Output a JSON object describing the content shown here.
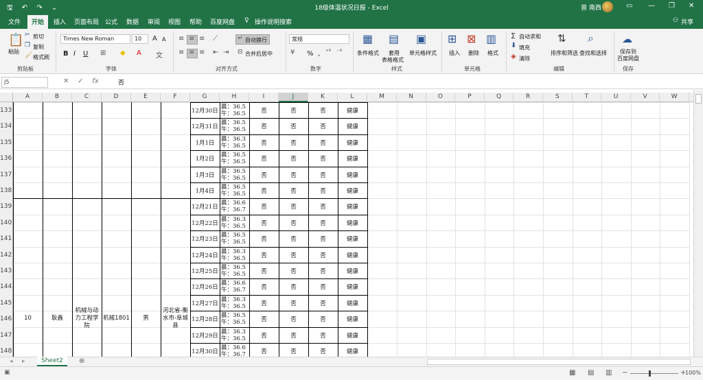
{
  "titlebar": {
    "title": "18级体温状况日报  -  Excel",
    "user": "曾 南西",
    "qa_save": "🖫",
    "qa_undo": "↶",
    "qa_redo": "↷",
    "qa_more": "⌄",
    "win_ribbon": "▭",
    "win_min": "—",
    "win_max": "❐",
    "win_close": "✕"
  },
  "tabs": {
    "items": [
      "文件",
      "开始",
      "插入",
      "页面布局",
      "公式",
      "数据",
      "审阅",
      "视图",
      "帮助",
      "百度网盘"
    ],
    "tell_me": "操作说明搜索",
    "share": "共享"
  },
  "ribbon": {
    "clipboard": {
      "paste": "粘贴",
      "cut": "剪切",
      "copy": "复制",
      "format_painter": "格式刷",
      "label": "剪贴板"
    },
    "font": {
      "name": "Times New Roman",
      "size": "10",
      "bold": "B",
      "italic": "I",
      "underline": "U",
      "label": "字体",
      "grow": "A",
      "shrink": "A"
    },
    "alignment": {
      "wrap": "自动换行",
      "merge": "合并后居中",
      "label": "对齐方式"
    },
    "number": {
      "format": "常规",
      "percent": "%",
      "comma": ",",
      "label": "数字"
    },
    "styles": {
      "conditional": "条件格式",
      "table_line1": "套用",
      "table_line2": "表格格式",
      "cell": "单元格样式",
      "label": "样式"
    },
    "cells": {
      "insert": "插入",
      "delete": "删除",
      "format": "格式",
      "label": "单元格"
    },
    "editing": {
      "autosum": "自动求和",
      "fill": "填充",
      "clear": "清除",
      "sort": "排序和筛选",
      "find": "查找和选择",
      "label": "编辑"
    },
    "save": {
      "line1": "保存到",
      "line2": "百度网盘",
      "label": "保存"
    }
  },
  "formula_bar": {
    "name_box": "J5",
    "fx": "fx",
    "value": "否"
  },
  "columns": [
    "A",
    "B",
    "C",
    "D",
    "E",
    "F",
    "G",
    "H",
    "I",
    "J",
    "K",
    "L",
    "M",
    "N",
    "O",
    "P",
    "Q",
    "R",
    "S",
    "T",
    "U",
    "V",
    "W"
  ],
  "selected_column": "J",
  "rows": [
    {
      "num": "133",
      "date": "12月30日",
      "temp_am": "晨：36.5",
      "temp_pm": "午：36.5",
      "i": "否",
      "j": "否",
      "k": "否",
      "l": "健康"
    },
    {
      "num": "134",
      "date": "12月31日",
      "temp_am": "晨：36.5",
      "temp_pm": "午：36.5",
      "i": "否",
      "j": "否",
      "k": "否",
      "l": "健康"
    },
    {
      "num": "135",
      "date": "1月1日",
      "temp_am": "晨：36.3",
      "temp_pm": "午：36.5",
      "i": "否",
      "j": "否",
      "k": "否",
      "l": "健康"
    },
    {
      "num": "136",
      "date": "1月2日",
      "temp_am": "晨：36.5",
      "temp_pm": "午：36.5",
      "i": "否",
      "j": "否",
      "k": "否",
      "l": "健康"
    },
    {
      "num": "137",
      "date": "1月3日",
      "temp_am": "晨：36.5",
      "temp_pm": "午：36.5",
      "i": "否",
      "j": "否",
      "k": "否",
      "l": "健康"
    },
    {
      "num": "138",
      "date": "1月4日",
      "temp_am": "晨：36.5",
      "temp_pm": "午：36.5",
      "i": "否",
      "j": "否",
      "k": "否",
      "l": "健康"
    },
    {
      "num": "139",
      "date": "12月21日",
      "temp_am": "晨：36.6",
      "temp_pm": "午：36.7",
      "i": "否",
      "j": "否",
      "k": "否",
      "l": "健康"
    },
    {
      "num": "140",
      "date": "12月22日",
      "temp_am": "晨：36.3",
      "temp_pm": "午：36.5",
      "i": "否",
      "j": "否",
      "k": "否",
      "l": "健康"
    },
    {
      "num": "141",
      "date": "12月23日",
      "temp_am": "晨：36.5",
      "temp_pm": "午：36.5",
      "i": "否",
      "j": "否",
      "k": "否",
      "l": "健康"
    },
    {
      "num": "142",
      "date": "12月24日",
      "temp_am": "晨：36.3",
      "temp_pm": "午：36.5",
      "i": "否",
      "j": "否",
      "k": "否",
      "l": "健康"
    },
    {
      "num": "143",
      "date": "12月25日",
      "temp_am": "晨：36.5",
      "temp_pm": "午：36.5",
      "i": "否",
      "j": "否",
      "k": "否",
      "l": "健康"
    },
    {
      "num": "144",
      "date": "12月26日",
      "temp_am": "晨：36.6",
      "temp_pm": "午：36.7",
      "i": "否",
      "j": "否",
      "k": "否",
      "l": "健康"
    },
    {
      "num": "145",
      "date": "12月27日",
      "temp_am": "晨：36.3",
      "temp_pm": "午：36.5",
      "i": "否",
      "j": "否",
      "k": "否",
      "l": "健康"
    },
    {
      "num": "146",
      "date": "12月28日",
      "temp_am": "晨：36.5",
      "temp_pm": "午：36.5",
      "i": "否",
      "j": "否",
      "k": "否",
      "l": "健康"
    },
    {
      "num": "147",
      "date": "12月29日",
      "temp_am": "晨：36.3",
      "temp_pm": "午：36.5",
      "i": "否",
      "j": "否",
      "k": "否",
      "l": "健康"
    },
    {
      "num": "148",
      "date": "12月30日",
      "temp_am": "晨：36.6",
      "temp_pm": "午：36.7",
      "i": "否",
      "j": "否",
      "k": "否",
      "l": "健康"
    }
  ],
  "merged": {
    "a": "10",
    "b": "耿鑫",
    "c": "机械与动力工程学院",
    "d": "机械1801",
    "e": "男",
    "f": "河北省-衡水市-阜城县"
  },
  "sheet": {
    "tab": "Sheet2",
    "add": "⊕"
  },
  "status": {
    "zoom": "100%"
  }
}
